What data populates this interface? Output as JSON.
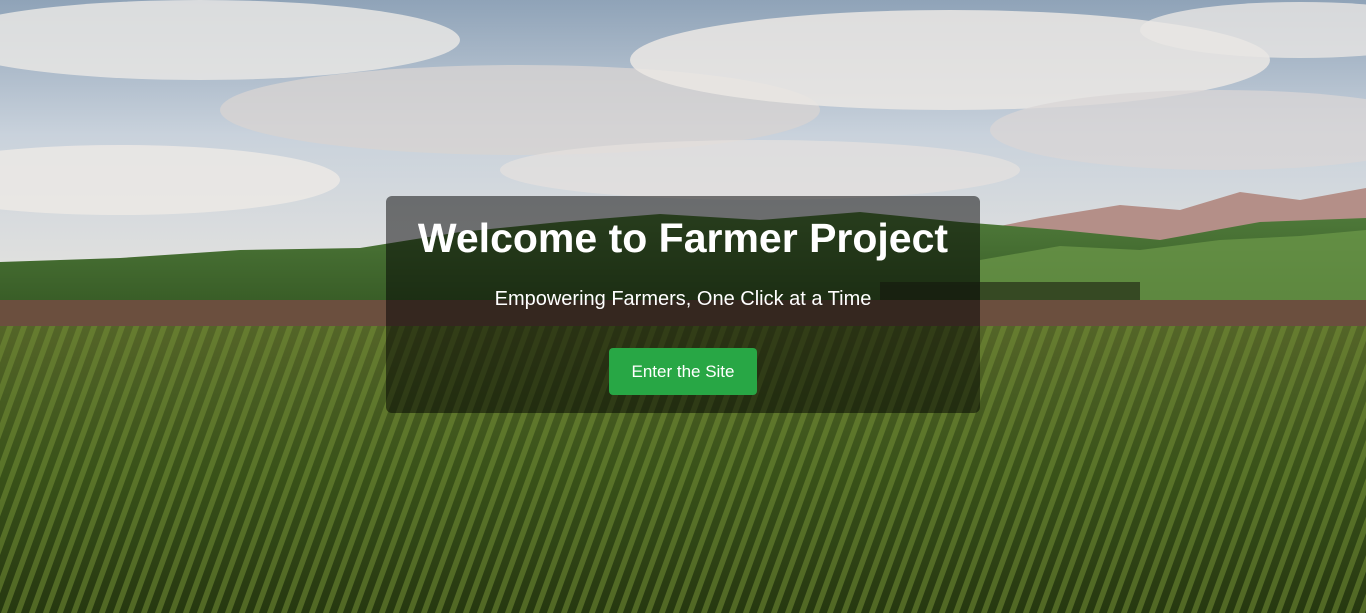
{
  "hero": {
    "title": "Welcome to Farmer Project",
    "subtitle": "Empowering Farmers, One Click at a Time",
    "button_label": "Enter the Site",
    "background_description_semantic": "farm-field-landscape-image"
  },
  "colors": {
    "button": "#28a745",
    "overlay": "rgba(0,0,0,0.5)",
    "text": "#ffffff"
  }
}
